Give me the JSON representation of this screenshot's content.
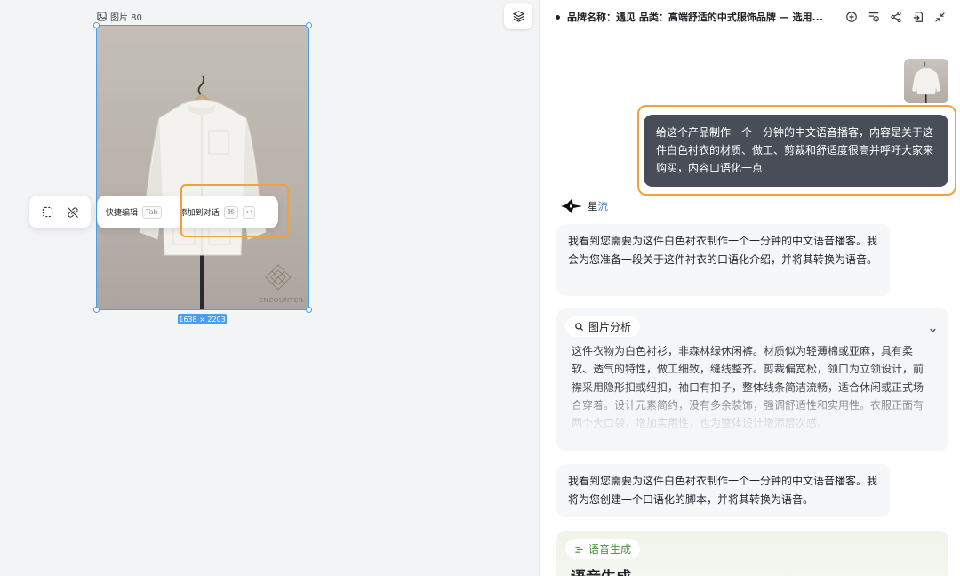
{
  "canvas": {
    "frame_label": "图片 80",
    "image_size": "1638 × 2203",
    "brand_watermark": "ENCOUNTER",
    "quick_toolbar": {
      "quick_edit_label": "快捷编辑",
      "quick_edit_key": "Tab",
      "add_to_chat_label": "添加到对话",
      "add_to_chat_key": "⌘",
      "enter_key": "↩"
    }
  },
  "chat": {
    "title": "品牌名称：遇见 品类：高端舒适的中式服饰品牌 — 选用...",
    "user_message": "给这个产品制作一个一分钟的中文语音播客，内容是关于这件白色衬衣的材质、做工、剪裁和舒适度很高并呼吁大家来购买，内容口语化一点",
    "assistant": {
      "name_prefix": "星",
      "name_suffix": "流"
    },
    "reply_1": "我看到您需要为这件白色衬衣制作一个一分钟的中文语音播客。我会为您准备一段关于这件衬衣的口语化介绍，并将其转换为语音。",
    "analysis": {
      "chip_label": "图片分析",
      "text": "这件衣物为白色衬衫，非森林绿休闲裤。材质似为轻薄棉或亚麻，具有柔软、透气的特性，做工细致，缝线整齐。剪裁偏宽松，领口为立领设计，前襟采用隐形扣或纽扣，袖口有扣子，整体线条简洁流畅，适合休闲或正式场合穿着。设计元素简约，没有多余装饰，强调舒适性和实用性。衣服正面有两个大口袋，增加实用性，也为整体设计增添层次感。"
    },
    "reply_2": "我看到您需要为这件白色衬衣制作一个一分钟的中文语音播客。我将为您创建一个口语化的脚本，并将其转换为语音。",
    "speech": {
      "chip_label": "语音生成",
      "title": "语音生成"
    }
  },
  "colors": {
    "selection": "#4a9ef0",
    "highlight": "#f0a23b",
    "user_bubble": "#484d57",
    "speech_accent": "#4c8a3e"
  }
}
